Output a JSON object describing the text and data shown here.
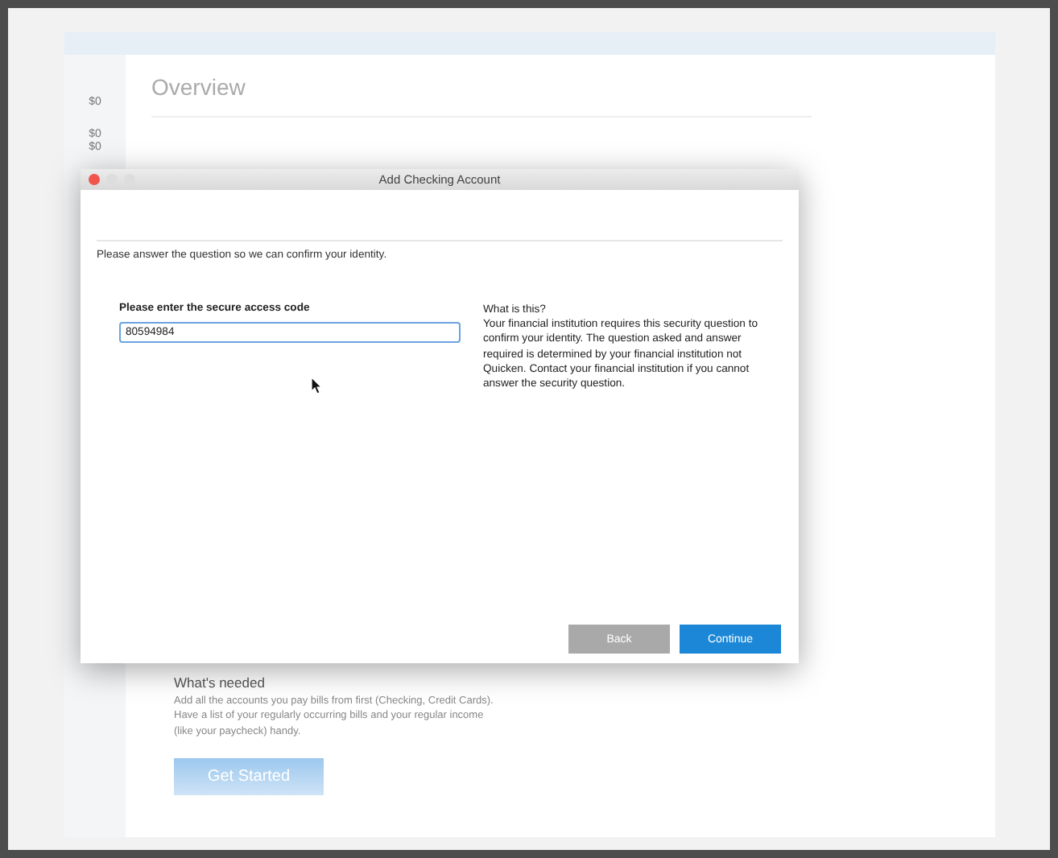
{
  "background": {
    "sidebar_amounts": [
      "$0",
      "$0",
      "$0"
    ],
    "heading": "Overview",
    "whats_needed": {
      "title": "What's needed",
      "text": "Add all the accounts you pay bills from first (Checking, Credit Cards). Have a list of your regularly occurring bills and your regular income (like your paycheck) handy."
    },
    "get_started_button": "Get Started"
  },
  "dialog": {
    "title": "Add Checking Account",
    "instruction": "Please answer the question so we can confirm your identity.",
    "field_label": "Please enter the secure access code",
    "field_value": "80594984",
    "help_title": "What is this?",
    "help_text": "Your financial institution requires this security question to confirm your identity. The question asked and answer required is determined by your financial institution not Quicken. Contact your financial institution if you cannot answer the security question.",
    "buttons": [
      {
        "label": "Back",
        "kind": "secondary"
      },
      {
        "label": "Continue",
        "kind": "primary"
      }
    ]
  }
}
